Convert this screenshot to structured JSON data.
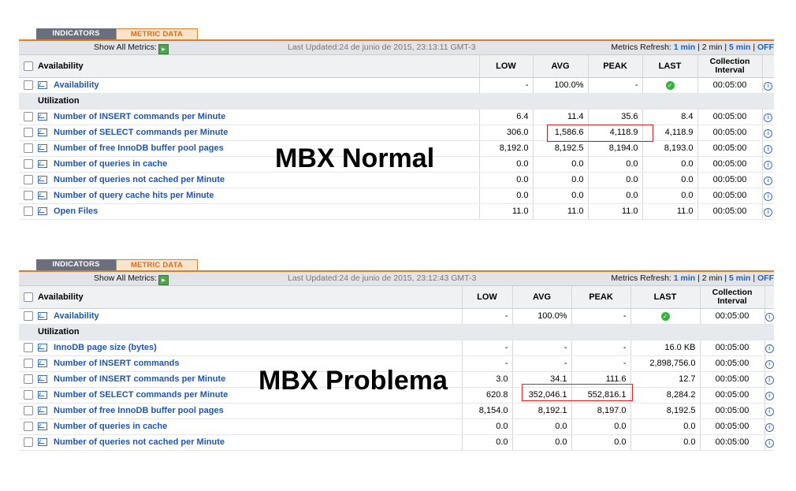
{
  "panels": [
    {
      "tabs": {
        "indicators": "INDICATORS",
        "metric_data": "METRIC DATA"
      },
      "show_all": "Show All Metrics:",
      "last_updated": "Last Updated:24 de junio de 2015, 23:13:11 GMT-3",
      "refresh": {
        "label": "Metrics Refresh:",
        "opt1": "1 min",
        "opt2": "2 min",
        "opt3": "5 min",
        "opt4": "OFF"
      },
      "headers": {
        "availability": "Availability",
        "low": "LOW",
        "avg": "AVG",
        "peak": "PEAK",
        "last": "LAST",
        "ci1": "Collection",
        "ci2": "Interval"
      },
      "availability_row": {
        "name": "Availability",
        "low": "-",
        "avg": "100.0%",
        "peak": "-",
        "ci": "00:05:00"
      },
      "section": "Utilization",
      "rows": [
        {
          "name": "Number of INSERT commands per Minute",
          "low": "6.4",
          "avg": "11.4",
          "peak": "35.6",
          "last": "8.4",
          "ci": "00:05:00"
        },
        {
          "name": "Number of SELECT commands per Minute",
          "low": "306.0",
          "avg": "1,586.6",
          "peak": "4,118.9",
          "last": "4,118.9",
          "ci": "00:05:00"
        },
        {
          "name": "Number of free InnoDB buffer pool pages",
          "low": "8,192.0",
          "avg": "8,192.5",
          "peak": "8,194.0",
          "last": "8,193.0",
          "ci": "00:05:00"
        },
        {
          "name": "Number of queries in cache",
          "low": "0.0",
          "avg": "0.0",
          "peak": "0.0",
          "last": "0.0",
          "ci": "00:05:00"
        },
        {
          "name": "Number of queries not cached per Minute",
          "low": "0.0",
          "avg": "0.0",
          "peak": "0.0",
          "last": "0.0",
          "ci": "00:05:00"
        },
        {
          "name": "Number of query cache hits per Minute",
          "low": "0.0",
          "avg": "0.0",
          "peak": "0.0",
          "last": "0.0",
          "ci": "00:05:00"
        },
        {
          "name": "Open Files",
          "low": "11.0",
          "avg": "11.0",
          "peak": "11.0",
          "last": "11.0",
          "ci": "00:05:00"
        }
      ],
      "overlay_label": "MBX Normal"
    },
    {
      "tabs": {
        "indicators": "INDICATORS",
        "metric_data": "METRIC DATA"
      },
      "show_all": "Show All Metrics:",
      "last_updated": "Last Updated:24 de junio de 2015, 23:12:43 GMT-3",
      "refresh": {
        "label": "Metrics Refresh:",
        "opt1": "1 min",
        "opt2": "2 min",
        "opt3": "5 min",
        "opt4": "OFF"
      },
      "headers": {
        "availability": "Availability",
        "low": "LOW",
        "avg": "AVG",
        "peak": "PEAK",
        "last": "LAST",
        "ci1": "Collection",
        "ci2": "Interval"
      },
      "availability_row": {
        "name": "Availability",
        "low": "-",
        "avg": "100.0%",
        "peak": "-",
        "ci": "00:05:00"
      },
      "section": "Utilization",
      "rows": [
        {
          "name": "InnoDB page size (bytes)",
          "low": "-",
          "avg": "-",
          "peak": "-",
          "last": "16.0 KB",
          "ci": "00:05:00"
        },
        {
          "name": "Number of INSERT commands",
          "low": "-",
          "avg": "-",
          "peak": "-",
          "last": "2,898,756.0",
          "ci": "00:05:00"
        },
        {
          "name": "Number of INSERT commands per Minute",
          "low": "3.0",
          "avg": "34.1",
          "peak": "111.6",
          "last": "12.7",
          "ci": "00:05:00"
        },
        {
          "name": "Number of SELECT commands per Minute",
          "low": "620.8",
          "avg": "352,046.1",
          "peak": "552,816.1",
          "last": "8,284.2",
          "ci": "00:05:00"
        },
        {
          "name": "Number of free InnoDB buffer pool pages",
          "low": "8,154.0",
          "avg": "8,192.1",
          "peak": "8,197.0",
          "last": "8,192.5",
          "ci": "00:05:00"
        },
        {
          "name": "Number of queries in cache",
          "low": "0.0",
          "avg": "0.0",
          "peak": "0.0",
          "last": "0.0",
          "ci": "00:05:00"
        },
        {
          "name": "Number of queries not cached per Minute",
          "low": "0.0",
          "avg": "0.0",
          "peak": "0.0",
          "last": "0.0",
          "ci": "00:05:00"
        }
      ],
      "overlay_label": "MBX Problema"
    }
  ],
  "colors": {
    "accent": "#e07a26",
    "link": "#1e56b0",
    "highlight": "#e02020",
    "ok": "#2fb52f"
  },
  "icons": [
    "chart-icon",
    "info-icon",
    "ok-icon",
    "add-icon"
  ]
}
